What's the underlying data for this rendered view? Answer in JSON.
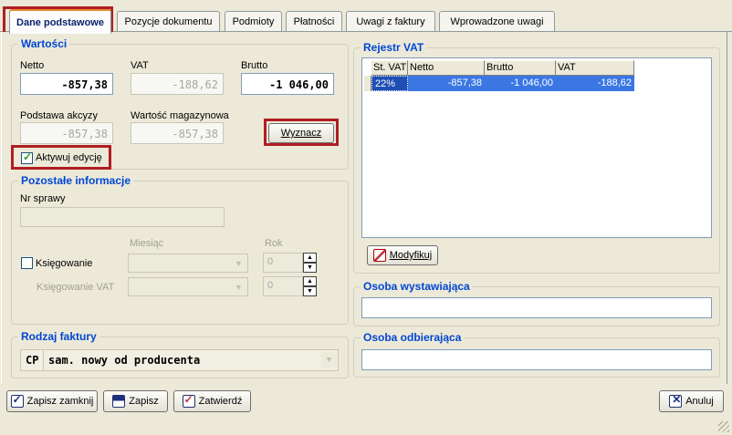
{
  "tabs": [
    {
      "label": "Dane podstawowe",
      "active": true
    },
    {
      "label": "Pozycje dokumentu"
    },
    {
      "label": "Podmioty"
    },
    {
      "label": "Płatności"
    },
    {
      "label": "Uwagi z faktury"
    },
    {
      "label": "Wprowadzone uwagi"
    }
  ],
  "wartosci": {
    "title": "Wartości",
    "netto_label": "Netto",
    "netto_value": "-857,38",
    "vat_label": "VAT",
    "vat_value": "-188,62",
    "brutto_label": "Brutto",
    "brutto_value": "-1 046,00",
    "akcyza_label": "Podstawa akcyzy",
    "akcyza_value": "-857,38",
    "magazyn_label": "Wartość magazynowa",
    "magazyn_value": "-857,38",
    "wyznacz_label": "Wyznacz",
    "aktywuj_label": "Aktywuj edycję",
    "aktywuj_checked": true
  },
  "pozostale": {
    "title": "Pozostałe informacje",
    "nr_sprawy_label": "Nr sprawy",
    "nr_sprawy_value": "",
    "miesiac_label": "Miesiąc",
    "rok_label": "Rok",
    "ksiegowanie_label": "Księgowanie",
    "ksiegowanie_checked": false,
    "ksiegowanie_rok": "0",
    "ksiegowanie_vat_label": "Księgowanie VAT",
    "ksiegowanie_vat_rok": "0"
  },
  "rodzaj": {
    "title": "Rodzaj faktury",
    "code": "CP",
    "value": "sam. nowy od producenta"
  },
  "rejestr": {
    "title": "Rejestr VAT",
    "columns": [
      "St. VAT",
      "Netto",
      "Brutto",
      "VAT"
    ],
    "rows": [
      [
        "22%",
        "-857,38",
        "-1 046,00",
        "-188,62"
      ]
    ],
    "modyfikuj_label": "Modyfikuj"
  },
  "osoba_wystawiajaca": {
    "title": "Osoba wystawiająca",
    "value": ""
  },
  "osoba_odbierajaca": {
    "title": "Osoba odbierająca",
    "value": ""
  },
  "footer": {
    "zapisz_zamknij": "Zapisz zamknij",
    "zapisz": "Zapisz",
    "zatwierdz": "Zatwierdź",
    "anuluj": "Anuluj"
  },
  "colors": {
    "highlight_frame": "#b01e22",
    "group_title": "#0046d5",
    "selection": "#3b77e3"
  }
}
